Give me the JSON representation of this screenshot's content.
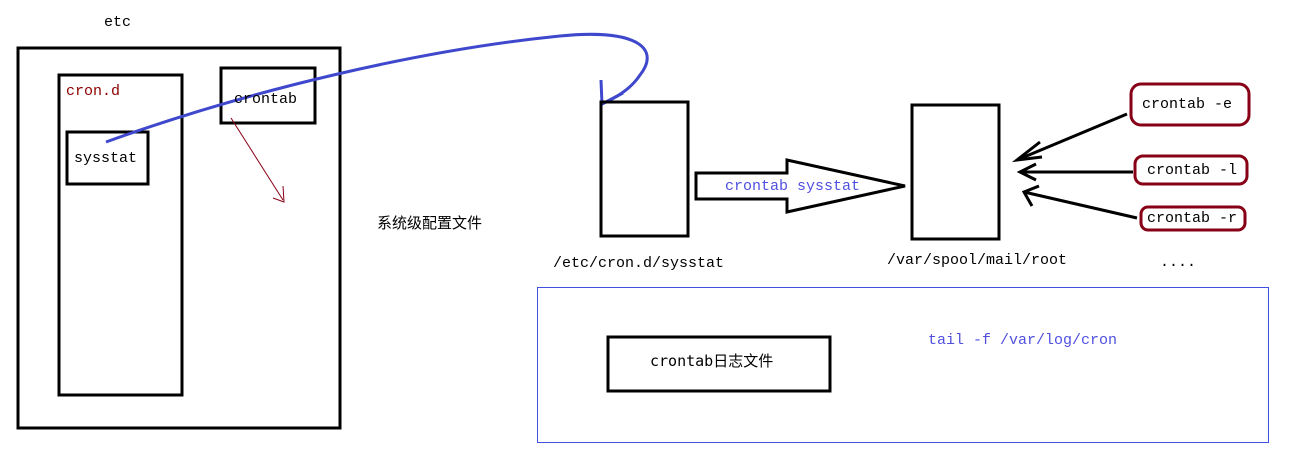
{
  "labels": {
    "etc": "etc",
    "cron_d": "cron.d",
    "crontab_file": "crontab",
    "sysstat_file": "sysstat",
    "system_config": "系统级配置文件",
    "etc_cron_d_sysstat": "/etc/cron.d/sysstat",
    "arrow_label": "crontab sysstat",
    "var_spool_mail_root": "/var/spool/mail/root",
    "ellipsis": "....",
    "log_file": "crontab日志文件",
    "tail_command": "tail -f /var/log/cron"
  },
  "commands": [
    "crontab -e",
    "crontab -l",
    "crontab -r"
  ],
  "colors": {
    "blue_curve": "#3f48cc",
    "red_accent": "#880015",
    "panel_border": "#4050e0"
  }
}
